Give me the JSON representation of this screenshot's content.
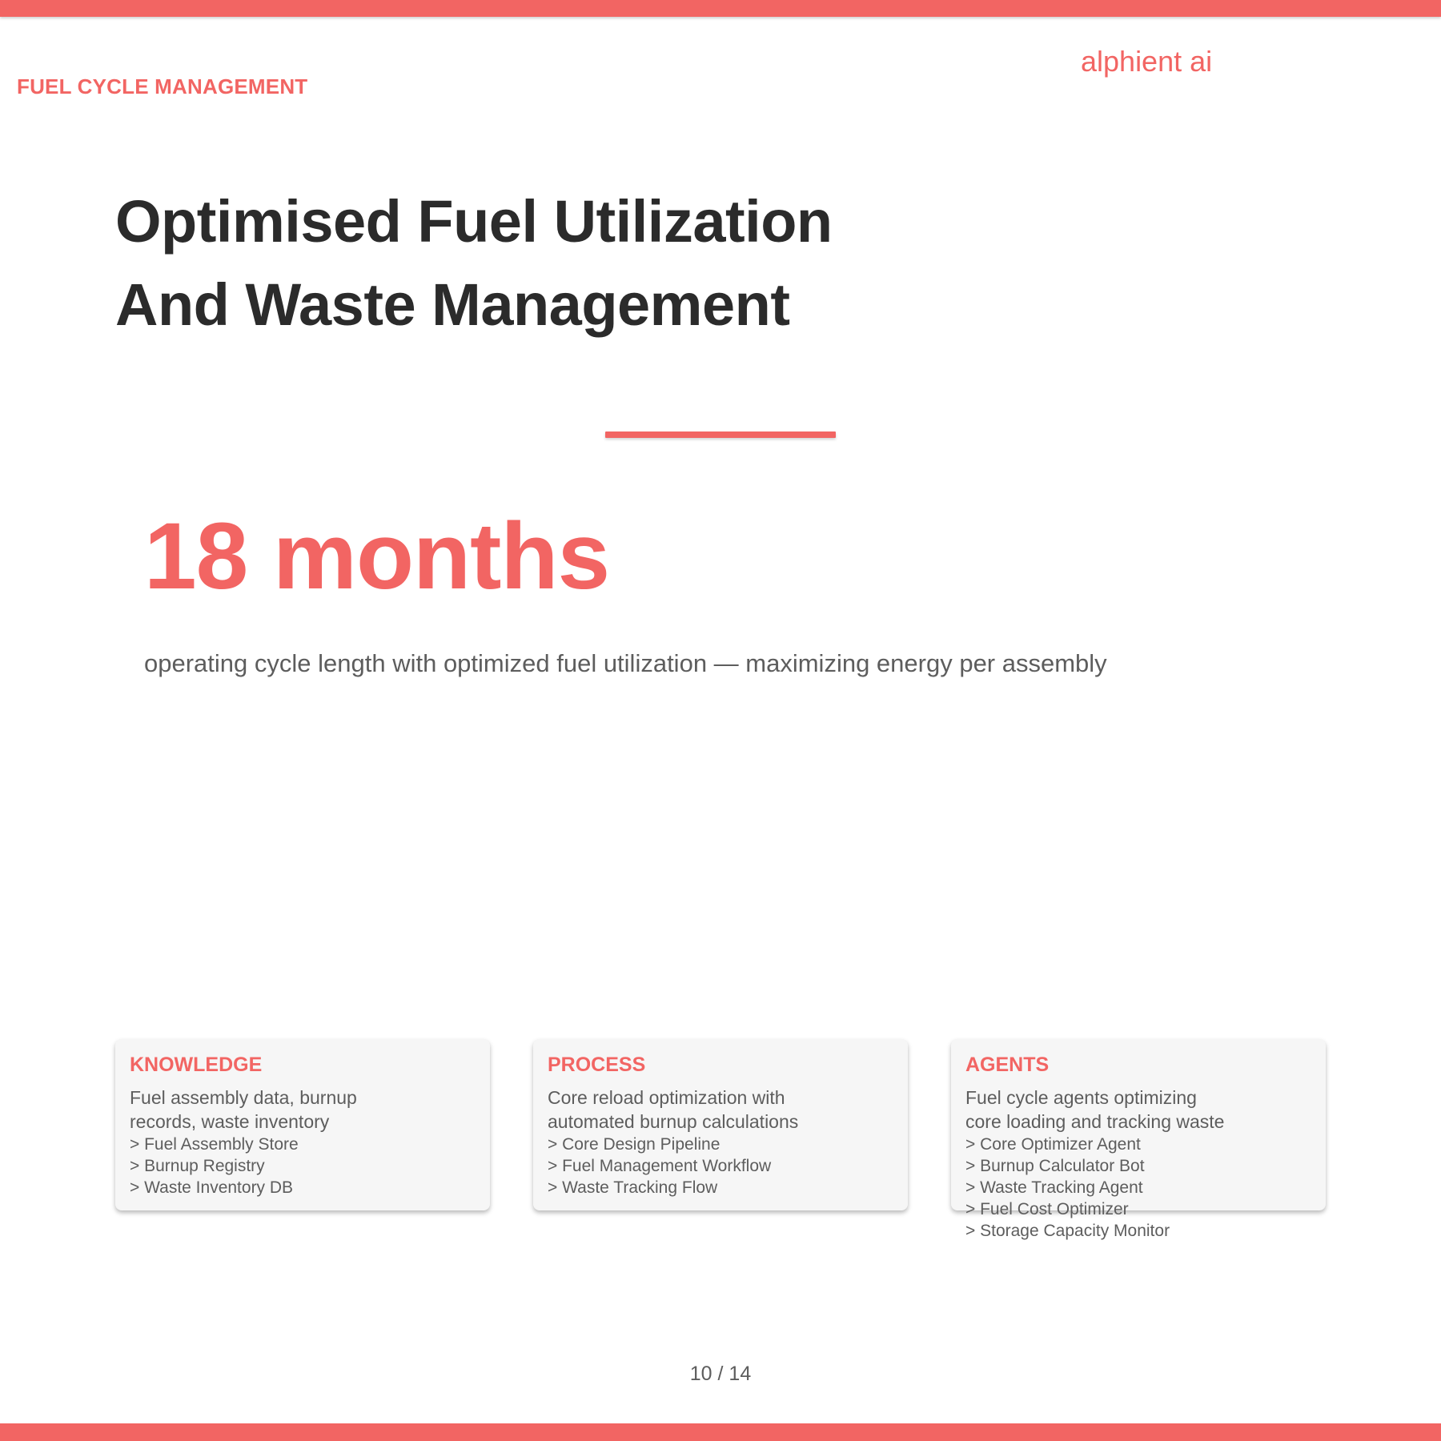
{
  "header": {
    "section_label": "FUEL CYCLE MANAGEMENT",
    "brand": "alphient ai"
  },
  "title": {
    "line1": "Optimised Fuel Utilization",
    "line2": "And Waste Management"
  },
  "stat": {
    "value": "18 months",
    "description": "operating cycle length with optimized fuel utilization — maximizing energy per assembly"
  },
  "cards": [
    {
      "title": "KNOWLEDGE",
      "description_lines": [
        "Fuel assembly data, burnup",
        "records, waste inventory"
      ],
      "items": [
        "Fuel Assembly Store",
        "Burnup Registry",
        "Waste Inventory DB"
      ]
    },
    {
      "title": "PROCESS",
      "description_lines": [
        "Core reload optimization with",
        "automated burnup calculations"
      ],
      "items": [
        "Core Design Pipeline",
        "Fuel Management Workflow",
        "Waste Tracking Flow"
      ]
    },
    {
      "title": "AGENTS",
      "description_lines": [
        "Fuel cycle agents optimizing",
        "core loading and tracking waste"
      ],
      "items": [
        "Core Optimizer Agent",
        "Burnup Calculator Bot",
        "Waste Tracking Agent",
        "Fuel Cost Optimizer",
        "Storage Capacity Monitor"
      ]
    }
  ],
  "footer": {
    "page_number": "10 / 14"
  },
  "colors": {
    "accent": "#f26563",
    "title_text": "#2b2b2b",
    "body_text": "#5d5d5d",
    "card_bg": "#f6f6f6"
  }
}
